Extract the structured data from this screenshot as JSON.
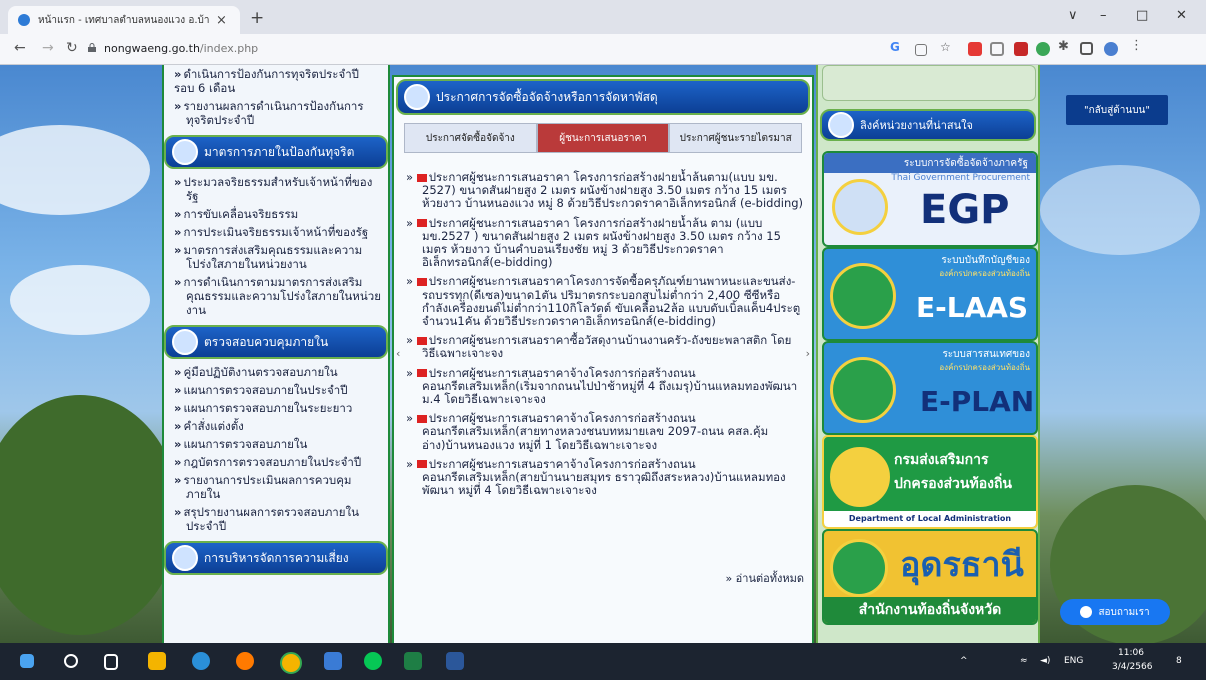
{
  "browser": {
    "tab_title": "หน้าแรก - เทศบาลตำบลหนองแวง อ.บ้านฝาง",
    "tab_close": "×",
    "new_tab": "+",
    "url_domain": "nongwaeng.go.th",
    "url_path": "/index.php",
    "window_controls": [
      "∨",
      "–",
      "□",
      "✕"
    ]
  },
  "left_column": {
    "top_items": [
      "ดำเนินการป้องกันการทุจริตประจำปี รอบ 6 เดือน",
      "รายงานผลการดำเนินการป้องกันการทุจริตประจำปี"
    ],
    "sections": [
      {
        "title": "มาตรการภายในป้องกันทุจริต",
        "items": [
          "ประมวลจริยธรรมสำหรับเจ้าหน้าที่ของรัฐ",
          "การขับเคลื่อนจริยธรรม",
          "การประเมินจริยธรรมเจ้าหน้าที่ของรัฐ",
          "มาตรการส่งเสริมคุณธรรมและความโปร่งใสภายในหน่วยงาน",
          "การดำเนินการตามมาตรการส่งเสริมคุณธรรมและความโปร่งใสภายในหน่วยงาน"
        ]
      },
      {
        "title": "ตรวจสอบควบคุมภายใน",
        "items": [
          "คู่มือปฏิบัติงานตรวจสอบภายใน",
          "แผนการตรวจสอบภายในประจำปี",
          "แผนการตรวจสอบภายในระยะยาว",
          "คำสั่งแต่งตั้ง",
          "แผนการตรวจสอบภายใน",
          "กฎบัตรการตรวจสอบภายในประจำปี",
          "รายงานการประเมินผลการควบคุมภายใน",
          "สรุปรายงานผลการตรวจสอบภายในประจำปี"
        ]
      },
      {
        "title": "การบริหารจัดการความเสี่ยง",
        "items": []
      }
    ]
  },
  "center": {
    "header": "ประกาศการจัดซื้อจัดจ้างหรือการจัดหาพัสดุ",
    "tabs": [
      "ประกาศจัดซื้อจัดจ้าง",
      "ผู้ชนะการเสนอราคา",
      "ประกาศผู้ชนะรายไตรมาส"
    ],
    "announcements": [
      "ประกาศผู้ชนะการเสนอราคา โครงการก่อสร้างฝายน้ำล้นตาม(แบบ มข. 2527) ขนาดสันฝายสูง 2 เมตร ผนังข้างฝายสูง 3.50 เมตร กว้าง 15 เมตร ห้วยงาว บ้านหนองแวง หมู่ 8 ด้วยวิธีประกวดราคาอิเล็กทรอนิกส์ (e-bidding)",
      "ประกาศผู้ชนะการเสนอราคา โครงการก่อสร้างฝายน้ำล้น ตาม (แบบ มข.2527 ) ขนาดสันฝายสูง 2 เมตร ผนังข้างฝายสูง 3.50 เมตร กว้าง 15 เมตร ห้วยงาว บ้านคำบอนเรียงชัย หมู่ 3 ด้วยวิธีประกวดราคาอิเล็กทรอนิกส์(e-bidding)",
      "ประกาศผู้ชนะการเสนอราคาโครงการจัดซื้อครุภัณฑ์ยานพาหนะและขนส่ง-รถบรรทุก(ดีเซล)ขนาด1ตัน ปริมาตรกระบอกสูบไม่ต่ำกว่า 2,400 ซีซีหรือกำลังเครื่องยนต์ไม่ต่ำกว่า110กิโลวัตต์ ขับเคลื่อน2ล้อ แบบดับเบิ้ลแค็บ4ประตูจำนวน1คัน ด้วยวิธีประกวดราคาอิเล็กทรอนิกส์(e-bidding)",
      "ประกาศผู้ชนะการเสนอราคาซื้อวัสดุงานบ้านงานครัว-ถังขยะพลาสติก โดยวิธีเฉพาะเจาะจง",
      "ประกาศผู้ชนะการเสนอราคาจ้างโครงการก่อสร้างถนนคอนกรีตเสริมเหล็ก(เริ่มจากถนนไปป่าช้าหมู่ที่ 4 ถึงเมรุ)บ้านแหลมทองพัฒนา ม.4 โดยวิธีเฉพาะเจาะจง",
      "ประกาศผู้ชนะการเสนอราคาจ้างโครงการก่อสร้างถนนคอนกรีตเสริมเหล็ก(สายทางหลวงชนบทหมายเลข 2097-ถนน คสล.คุ้มอ่าง)บ้านหนองแวง หมู่ที่ 1 โดยวิธีเฉพาะเจาะจง",
      "ประกาศผู้ชนะการเสนอราคาจ้างโครงการก่อสร้างถนนคอนกรีตเสริมเหล็ก(สายบ้านนายสมุทร ธราวุฒิถึงสระหลวง)บ้านแหลมทองพัฒนา หมู่ที่ 4 โดยวิธีเฉพาะเจาะจง"
    ],
    "read_more": "» อ่านต่อทั้งหมด"
  },
  "right_column": {
    "header": "ลิงค์หน่วยงานที่น่าสนใจ",
    "banners": [
      {
        "subtitle": "ระบบการจัดซื้อจัดจ้างภาครัฐ",
        "small": "Thai Government Procurement",
        "title": "EGP"
      },
      {
        "subtitle": "ระบบบันทึกบัญชีของ",
        "small": "องค์กรปกครองส่วนท้องถิ่น",
        "title": "E-LAAS"
      },
      {
        "subtitle": "ระบบสารสนเทศของ",
        "small": "องค์กรปกครองส่วนท้องถิ่น",
        "title": "E-PLAN"
      },
      {
        "subtitle": "กรมส่งเสริมการ",
        "small": "ปกครองส่วนท้องถิ่น",
        "title": "Department of Local Administration"
      },
      {
        "subtitle": "อุดรธานี",
        "small": "",
        "title": "สำนักงานท้องถิ่นจังหวัด"
      }
    ]
  },
  "page_buttons": {
    "back_to_top": "\"กลับสู่ด้านบน\"",
    "chat": "สอบถามเรา"
  },
  "taskbar": {
    "language": "ENG",
    "time": "11:06",
    "date": "3/4/2566",
    "notifications": "8"
  },
  "colors": {
    "header_blue": "#0c3f95",
    "border_green": "#1e8a3a",
    "active_tab_red": "#ba3a3a"
  }
}
